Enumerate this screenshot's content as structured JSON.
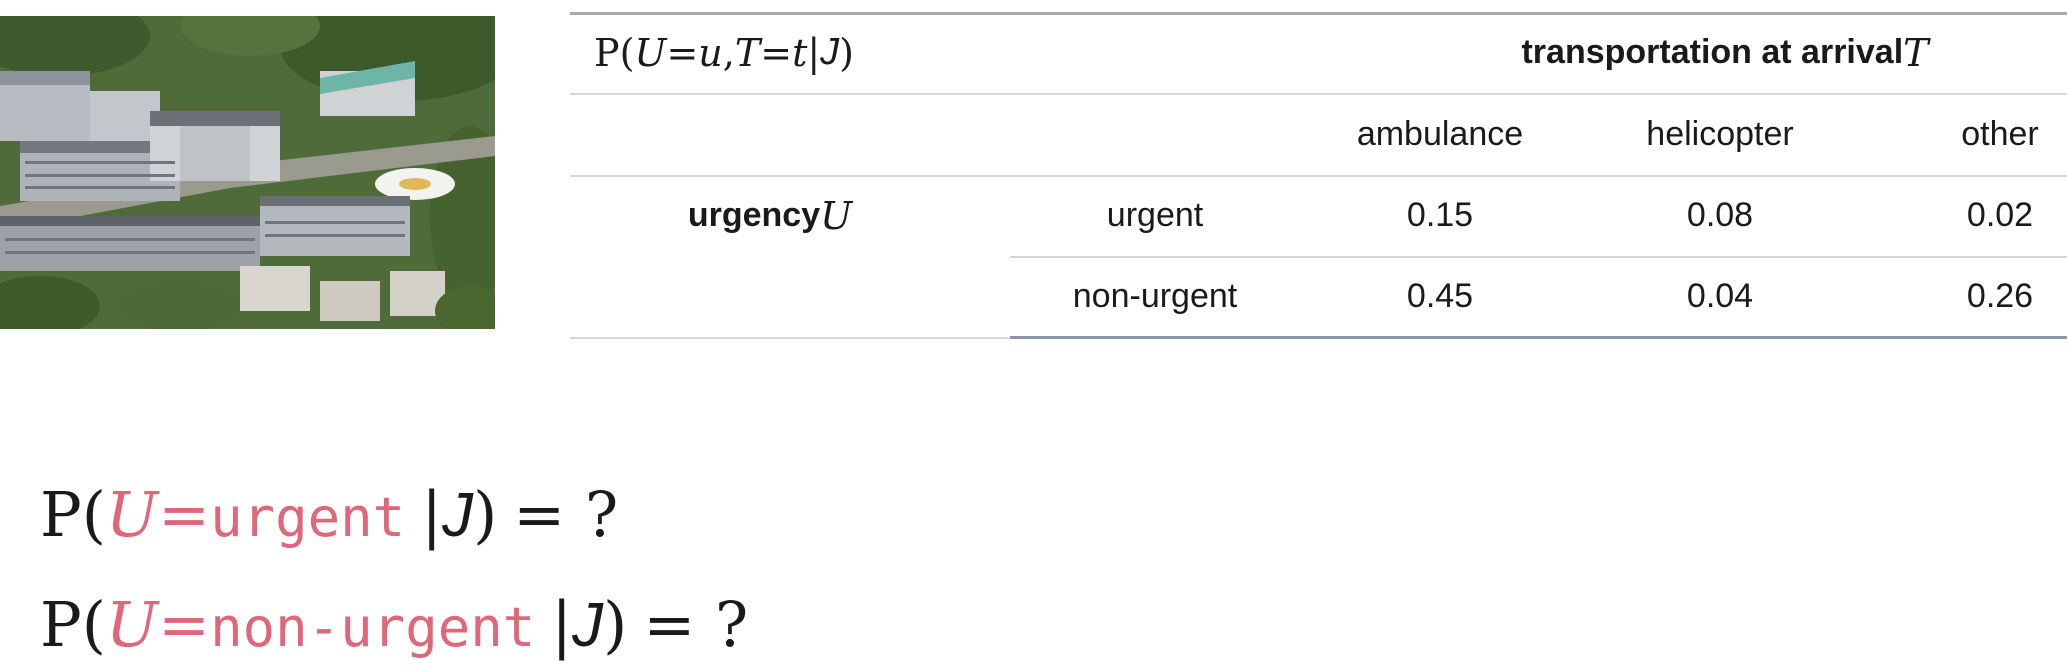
{
  "table": {
    "formula": {
      "P": "P(",
      "U": "U",
      "eq1": "=",
      "u": "u",
      "comma": " , ",
      "T": "T",
      "eq2": "=",
      "t": "t",
      "bar": " | ",
      "J": "J",
      "close": ")"
    },
    "column_header": {
      "label": "transportation at arrival ",
      "var": "T"
    },
    "columns": [
      "ambulance",
      "helicopter",
      "other"
    ],
    "row_header": {
      "label": "urgency ",
      "var": "U"
    },
    "rows": [
      {
        "label": "urgent",
        "values": [
          "0.15",
          "0.08",
          "0.02"
        ]
      },
      {
        "label": "non-urgent",
        "values": [
          "0.45",
          "0.04",
          "0.26"
        ]
      }
    ]
  },
  "questions": [
    {
      "P": "P(",
      "U": "U",
      "eq": "=",
      "value": "urgent",
      "bar": "|",
      "J": "J",
      "close": ")",
      "rest": "= ?"
    },
    {
      "P": "P(",
      "U": "U",
      "eq": "=",
      "value": "non-urgent",
      "bar": "|",
      "J": "J",
      "close": ")",
      "rest": "= ?"
    }
  ],
  "colors": {
    "highlight": "#e0677a",
    "rule_dark": "#8c96a8",
    "rule_light": "#d6d6d6"
  }
}
